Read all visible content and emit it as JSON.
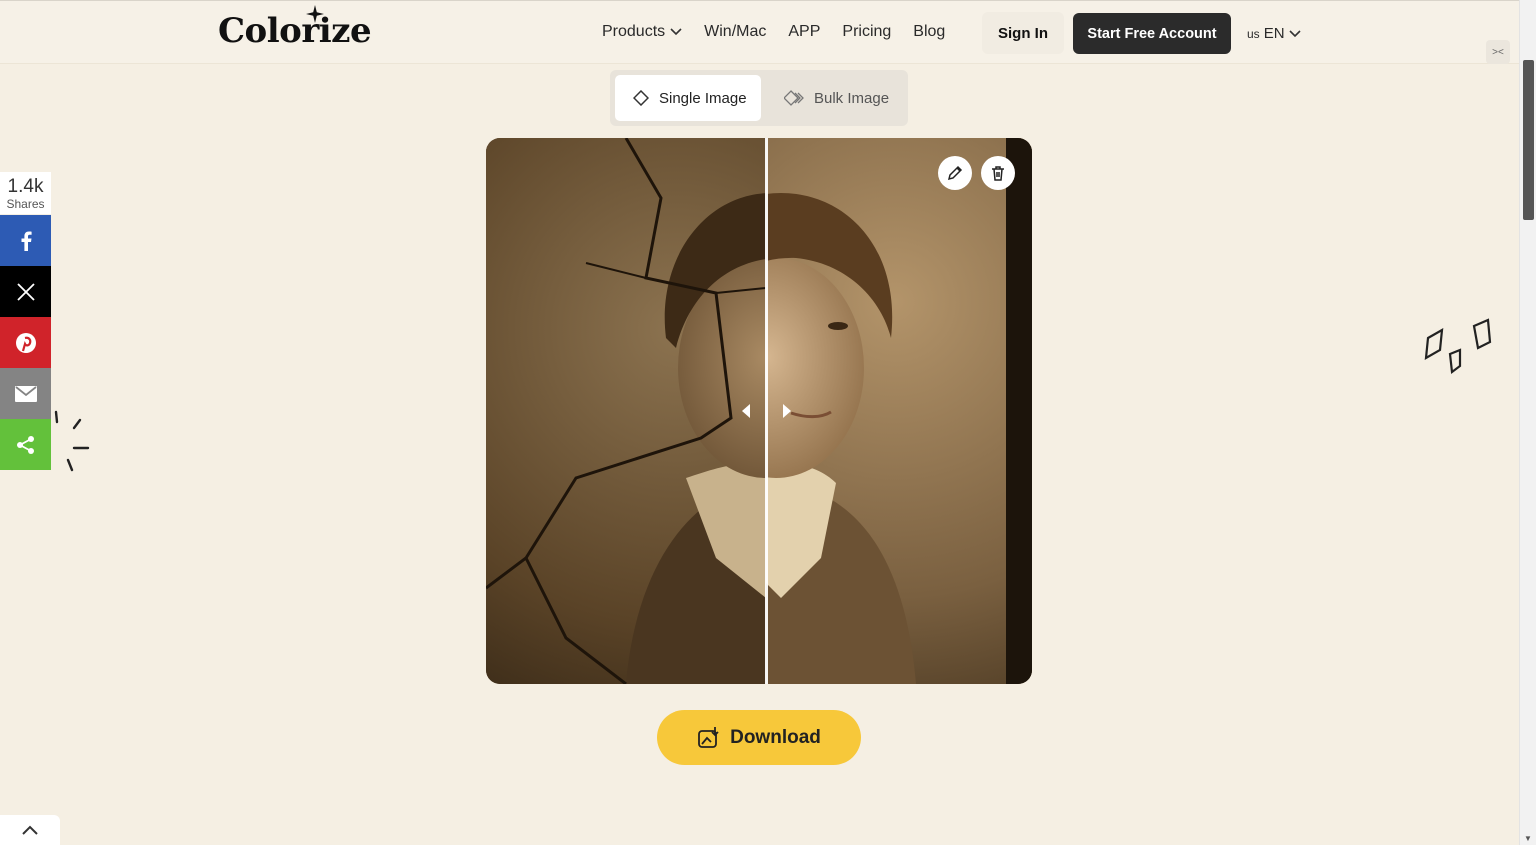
{
  "header": {
    "logo": "Colorize",
    "nav": [
      {
        "label": "Products"
      },
      {
        "label": "Win/Mac"
      },
      {
        "label": "APP"
      },
      {
        "label": "Pricing"
      },
      {
        "label": "Blog"
      }
    ],
    "sign_in": "Sign In",
    "start_free": "Start Free Account",
    "lang_flag": "us",
    "lang": "EN"
  },
  "mode_toggle": {
    "single": "Single Image",
    "bulk": "Bulk Image",
    "selected": "Single Image"
  },
  "compare": {
    "divider_position": 0.51
  },
  "download": {
    "label": "Download"
  },
  "share_bar": {
    "count": "1.4k",
    "label": "Shares",
    "networks": [
      "facebook-icon",
      "x-icon",
      "pinterest-icon",
      "email-icon",
      "share-icon"
    ]
  },
  "colors": {
    "accent": "#f7c83a",
    "background": "#f5efe3",
    "facebook": "#2d5bb4",
    "pinterest": "#d0232a",
    "share": "#63c13b"
  }
}
